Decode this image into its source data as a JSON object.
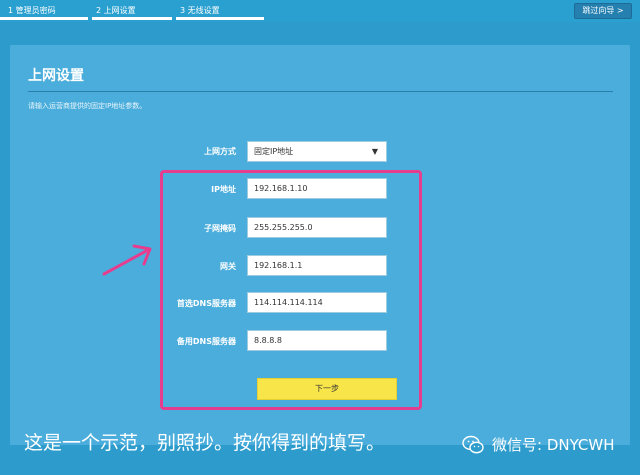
{
  "steps": [
    {
      "label": "1 管理员密码",
      "active": false
    },
    {
      "label": "2 上网设置",
      "active": true
    },
    {
      "label": "3 无线设置",
      "active": false
    }
  ],
  "skip_label": "跳过向导 >",
  "panel": {
    "title": "上网设置",
    "hint": "请输入运营商提供的固定IP地址参数。"
  },
  "form": {
    "mode_label": "上网方式",
    "mode_value": "固定IP地址",
    "ip_label": "IP地址",
    "ip_value": "192.168.1.10",
    "mask_label": "子网掩码",
    "mask_value": "255.255.255.0",
    "gateway_label": "网关",
    "gateway_value": "192.168.1.1",
    "dns1_label": "首选DNS服务器",
    "dns1_value": "114.114.114.114",
    "dns2_label": "备用DNS服务器",
    "dns2_value": "8.8.8.8",
    "next_label": "下一步"
  },
  "annotation": {
    "caption": "这是一个示范，别照抄。按你得到的填写。",
    "wechat": "微信号: DNYCWH",
    "highlight_color": "#e73d8e"
  },
  "colors": {
    "background": "#2d9ccc",
    "panel": "#4aaddb",
    "next_button": "#f8e54a"
  }
}
